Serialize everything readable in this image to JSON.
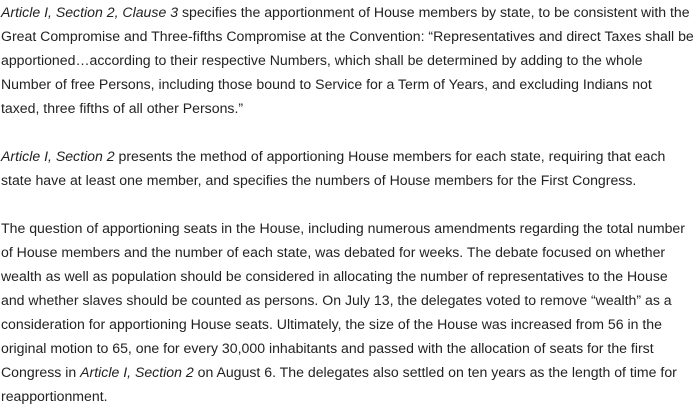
{
  "paragraphs": [
    {
      "cite": "Article I, Section 2, Clause 3",
      "text": " specifies the apportionment of House members by state, to be consistent with the Great Compromise and Three-fifths Compromise at the Convention: “Representatives and direct Taxes shall be apportioned…according to their respective Numbers, which shall be determined by adding to the whole Number of free Persons, including those bound to Service for a Term of Years, and excluding Indians not taxed, three fifths of all other Persons.”"
    },
    {
      "cite": "Article I, Section 2",
      "text": " presents the method of apportioning House members for each state, requiring that each state have at least one member, and specifies the numbers of House members for the First Congress."
    },
    {
      "text_before": "The question of apportioning seats in the House, including numerous amendments regarding the total number of House members and the number of each state, was debated for weeks. The debate focused on whether wealth as well as population should be considered in allocating the number of representatives to the House and whether slaves should be counted as persons. On July 13, the delegates voted to remove “wealth” as a consideration for apportioning House seats. Ultimately, the size of the House was increased from 56 in the original motion to 65, one for every 30,000 inhabitants and passed with the allocation of seats for the first Congress in ",
      "cite": "Article I, Section 2",
      "text_after": " on August 6. The delegates also settled on ten years as the length of time for reapportionment."
    }
  ]
}
